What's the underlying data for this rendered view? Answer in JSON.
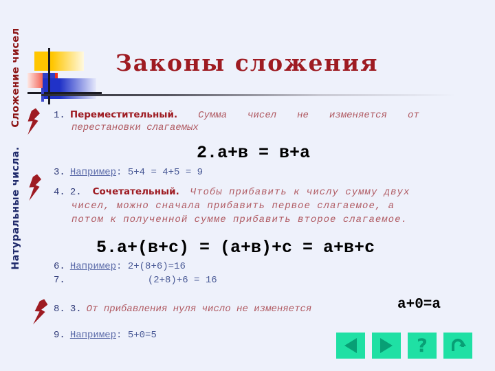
{
  "slide": {
    "title": "Законы сложения",
    "background_color": "#eef1fb",
    "title_color": "#9e1b22"
  },
  "sidebar": {
    "top_label": "Сложение чисел",
    "bottom_label": "Натуральные числа.",
    "top_color": "#8c1515",
    "bottom_color": "#1f2a6b",
    "bolt_color": "#9e1b22",
    "bolts": 3
  },
  "logo": {
    "yellow": "#ffc600",
    "red": "#f03020",
    "blue": "#2032c8",
    "line": "#1a1a22"
  },
  "content": {
    "item1": {
      "number": "1.",
      "lead": "Переместительный.",
      "text_a": "Сумма",
      "text_b": "чисел",
      "text_c": "не",
      "text_d": "изменяется",
      "text_e": "от",
      "text_line2": "перестановки слагаемых"
    },
    "item2": {
      "formula": "2.а+в = в+а"
    },
    "item3": {
      "number": "3.",
      "example_label": "Например",
      "text": ": 5+4 = 4+5 = 9"
    },
    "item4": {
      "number": "4.",
      "sub": "2.",
      "lead": "Сочетательный.",
      "line1": "Чтобы прибавить к числу сумму двух",
      "line2": "чисел, можно сначала прибавить первое слагаемое, а",
      "line3": "потом к полученной сумме прибавить второе слагаемое."
    },
    "item5": {
      "formula": "5.а+(в+с) = (а+в)+с = а+в+с"
    },
    "item6": {
      "number": "6.",
      "example_label": "Например",
      "text": ": 2+(8+6)=16"
    },
    "item7": {
      "number": "7.",
      "text": "(2+8)+6 = 16"
    },
    "item8": {
      "number": "8.",
      "sub": "3.",
      "text": "От прибавления нуля число не изменяется",
      "formula": "a+0=a"
    },
    "item9": {
      "number": "9.",
      "example_label": "Например",
      "text": ": 5+0=5"
    }
  },
  "nav": {
    "button_color": "#1fe0a4",
    "glyph_color": "#089f75",
    "buttons": [
      {
        "name": "previous",
        "glyph": "◀"
      },
      {
        "name": "next",
        "glyph": "▶"
      },
      {
        "name": "help",
        "glyph": "?"
      },
      {
        "name": "return",
        "glyph": "↺"
      }
    ],
    "help_label": "?"
  }
}
